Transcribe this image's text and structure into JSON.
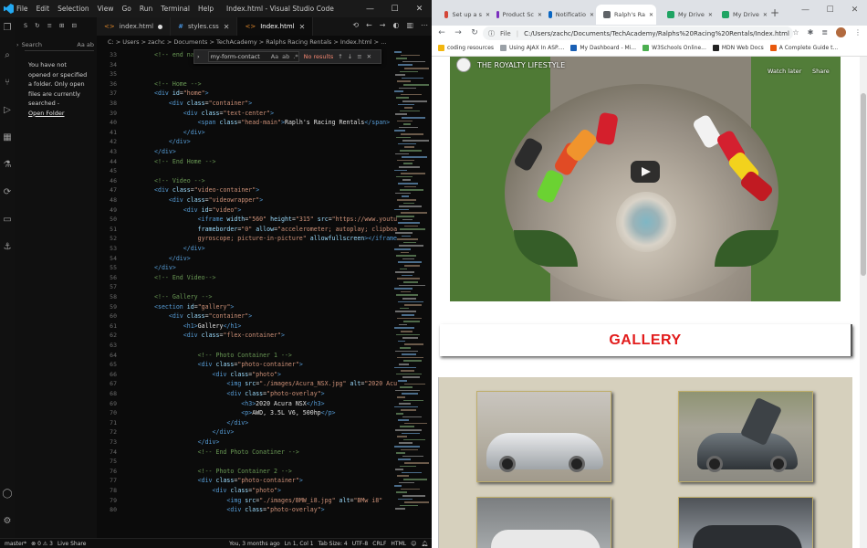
{
  "vscode": {
    "title": "Index.html - Visual Studio Code",
    "menu": [
      "File",
      "Edit",
      "Selection",
      "View",
      "Go",
      "Run",
      "Terminal",
      "Help"
    ],
    "sidebar": {
      "header": "S",
      "search_placeholder": "Search",
      "search_opts": "Aa ab",
      "message": "You have not opened or specified a folder. Only open files are currently searched -",
      "link": "Open Folder"
    },
    "tabs": [
      {
        "label": "index.html",
        "state": "modified"
      },
      {
        "label": "styles.css",
        "state": "close"
      },
      {
        "label": "Index.html",
        "state": "active"
      }
    ],
    "breadcrumb": "C: > Users > zachc > Documents > TechAcademy > Ralphs Racing Rentals > Index.html > ...",
    "find": {
      "value": "my-form-contact",
      "result": "No results"
    },
    "lines": [
      {
        "n": "33",
        "html": "<span class='c-com'>&lt;!-- end na</span>"
      },
      {
        "n": "34",
        "html": ""
      },
      {
        "n": "35",
        "html": ""
      },
      {
        "n": "36",
        "html": "<span class='c-com'>&lt;!-- Home --&gt;</span>"
      },
      {
        "n": "37",
        "html": "<span class='c-tag'>&lt;div</span> <span class='c-attr'>id</span>=<span class='c-str'>\"home\"</span><span class='c-tag'>&gt;</span>"
      },
      {
        "n": "38",
        "html": "    <span class='c-tag'>&lt;div</span> <span class='c-attr'>class</span>=<span class='c-str'>\"container\"</span><span class='c-tag'>&gt;</span>"
      },
      {
        "n": "39",
        "html": "        <span class='c-tag'>&lt;div</span> <span class='c-attr'>class</span>=<span class='c-str'>\"text-center\"</span><span class='c-tag'>&gt;</span>"
      },
      {
        "n": "40",
        "html": "            <span class='c-tag'>&lt;span</span> <span class='c-attr'>class</span>=<span class='c-str'>\"head-main\"</span><span class='c-tag'>&gt;</span><span class='c-txt'>Raplh's Racing Rentals</span><span class='c-tag'>&lt;/span&gt;</span>"
      },
      {
        "n": "41",
        "html": "        <span class='c-tag'>&lt;/div&gt;</span>"
      },
      {
        "n": "42",
        "html": "    <span class='c-tag'>&lt;/div&gt;</span>"
      },
      {
        "n": "43",
        "html": "<span class='c-tag'>&lt;/div&gt;</span>"
      },
      {
        "n": "44",
        "html": "<span class='c-com'>&lt;!-- End Home --&gt;</span>"
      },
      {
        "n": "45",
        "html": ""
      },
      {
        "n": "46",
        "html": "<span class='c-com'>&lt;!-- Video --&gt;</span>"
      },
      {
        "n": "47",
        "html": "<span class='c-tag'>&lt;div</span> <span class='c-attr'>class</span>=<span class='c-str'>\"video-container\"</span><span class='c-tag'>&gt;</span>"
      },
      {
        "n": "48",
        "html": "    <span class='c-tag'>&lt;div</span> <span class='c-attr'>class</span>=<span class='c-str'>\"videowrapper\"</span><span class='c-tag'>&gt;</span>"
      },
      {
        "n": "49",
        "html": "        <span class='c-tag'>&lt;div</span> <span class='c-attr'>id</span>=<span class='c-str'>\"video\"</span><span class='c-tag'>&gt;</span>"
      },
      {
        "n": "50",
        "html": "            <span class='c-tag'>&lt;iframe</span> <span class='c-attr'>width</span>=<span class='c-str'>\"560\"</span> <span class='c-attr'>height</span>=<span class='c-str'>\"315\"</span> <span class='c-attr'>src</span>=<span class='c-str'>\"https://www.youtu</span>"
      },
      {
        "n": "51",
        "html": "            <span class='c-attr'>frameborder</span>=<span class='c-str'>\"0\"</span> <span class='c-attr'>allow</span>=<span class='c-str'>\"accelerometer; autoplay; clipboa</span>"
      },
      {
        "n": "52",
        "html": "            <span class='c-str'>gyroscope; picture-in-picture\"</span> <span class='c-attr'>allowfullscreen</span><span class='c-tag'>&gt;&lt;/iframe</span>"
      },
      {
        "n": "53",
        "html": "        <span class='c-tag'>&lt;/div&gt;</span>"
      },
      {
        "n": "54",
        "html": "    <span class='c-tag'>&lt;/div&gt;</span>"
      },
      {
        "n": "55",
        "html": "<span class='c-tag'>&lt;/div&gt;</span>"
      },
      {
        "n": "56",
        "html": "<span class='c-com'>&lt;!-- End Video--&gt;</span>"
      },
      {
        "n": "57",
        "html": ""
      },
      {
        "n": "58",
        "html": "<span class='c-com'>&lt;!-- Gallery --&gt;</span>"
      },
      {
        "n": "59",
        "html": "<span class='c-tag'>&lt;section</span> <span class='c-attr'>id</span>=<span class='c-str'>\"gallery\"</span><span class='c-tag'>&gt;</span>"
      },
      {
        "n": "60",
        "html": "    <span class='c-tag'>&lt;div</span> <span class='c-attr'>class</span>=<span class='c-str'>\"container\"</span><span class='c-tag'>&gt;</span>"
      },
      {
        "n": "61",
        "html": "        <span class='c-tag'>&lt;h1&gt;</span><span class='c-txt'>Gallery</span><span class='c-tag'>&lt;/h1&gt;</span>"
      },
      {
        "n": "62",
        "html": "        <span class='c-tag'>&lt;div</span> <span class='c-attr'>class</span>=<span class='c-str'>\"flex-container\"</span><span class='c-tag'>&gt;</span>"
      },
      {
        "n": "63",
        "html": ""
      },
      {
        "n": "64",
        "html": "            <span class='c-com'>&lt;!-- Photo Container 1 --&gt;</span>"
      },
      {
        "n": "65",
        "html": "            <span class='c-tag'>&lt;div</span> <span class='c-attr'>class</span>=<span class='c-str'>\"photo-container\"</span><span class='c-tag'>&gt;</span>"
      },
      {
        "n": "66",
        "html": "                <span class='c-tag'>&lt;div</span> <span class='c-attr'>class</span>=<span class='c-str'>\"photo\"</span><span class='c-tag'>&gt;</span>"
      },
      {
        "n": "67",
        "html": "                    <span class='c-tag'>&lt;img</span> <span class='c-attr'>src</span>=<span class='c-str'>\"./images/Acura_NSX.jpg\"</span> <span class='c-attr'>alt</span>=<span class='c-str'>\"2020 Acu</span>"
      },
      {
        "n": "68",
        "html": "                    <span class='c-tag'>&lt;div</span> <span class='c-attr'>class</span>=<span class='c-str'>\"photo-overlay\"</span><span class='c-tag'>&gt;</span>"
      },
      {
        "n": "69",
        "html": "                        <span class='c-tag'>&lt;h3&gt;</span><span class='c-txt'>2020 Acura NSX</span><span class='c-tag'>&lt;/h3&gt;</span>"
      },
      {
        "n": "70",
        "html": "                        <span class='c-tag'>&lt;p&gt;</span><span class='c-txt'>AWD, 3.5L V6, 500hp</span><span class='c-tag'>&lt;/p&gt;</span>"
      },
      {
        "n": "71",
        "html": "                    <span class='c-tag'>&lt;/div&gt;</span>"
      },
      {
        "n": "72",
        "html": "                <span class='c-tag'>&lt;/div&gt;</span>"
      },
      {
        "n": "73",
        "html": "            <span class='c-tag'>&lt;/div&gt;</span>"
      },
      {
        "n": "74",
        "html": "            <span class='c-com'>&lt;!-- End Photo Conatiner --&gt;</span>"
      },
      {
        "n": "75",
        "html": ""
      },
      {
        "n": "76",
        "html": "            <span class='c-com'>&lt;!-- Photo Container 2 --&gt;</span>"
      },
      {
        "n": "77",
        "html": "            <span class='c-tag'>&lt;div</span> <span class='c-attr'>class</span>=<span class='c-str'>\"photo-container\"</span><span class='c-tag'>&gt;</span>"
      },
      {
        "n": "78",
        "html": "                <span class='c-tag'>&lt;div</span> <span class='c-attr'>class</span>=<span class='c-str'>\"photo\"</span><span class='c-tag'>&gt;</span>"
      },
      {
        "n": "79",
        "html": "                    <span class='c-tag'>&lt;img</span> <span class='c-attr'>src</span>=<span class='c-str'>\"./images/BMW_i8.jpg\"</span> <span class='c-attr'>alt</span>=<span class='c-str'>\"BMw i8\"</span>"
      },
      {
        "n": "80",
        "html": "                    <span class='c-tag'>&lt;div</span> <span class='c-attr'>class</span>=<span class='c-str'>\"photo-overlay\"</span><span class='c-tag'>&gt;</span>"
      }
    ],
    "status": {
      "branch": "master*",
      "problems": "⊗ 0 ⚠ 3",
      "live_share": "Live Share",
      "blame": "You, 3 months ago",
      "position": "Ln 1, Col 1",
      "tab_size": "Tab Size: 4",
      "encoding": "UTF-8",
      "eol": "CRLF",
      "language": "HTML"
    }
  },
  "chrome": {
    "tabs": [
      {
        "label": "Set up a s",
        "color": "#d44638"
      },
      {
        "label": "Product Sc",
        "color": "#7b2fbe"
      },
      {
        "label": "Notificatio",
        "color": "#0a66c2"
      },
      {
        "label": "Ralph's Ra",
        "color": "#5f6368"
      },
      {
        "label": "My Drive",
        "color": "#1fa463"
      },
      {
        "label": "My Drive",
        "color": "#1fa463"
      }
    ],
    "address": "C:/Users/zachc/Documents/TechAcademy/Ralphs%20Racing%20Rentals/Index.html",
    "address_prefix": "File",
    "bookmarks": [
      {
        "label": "coding resources",
        "color": "#f2b60f"
      },
      {
        "label": "Using AJAX In ASP....",
        "color": "#9aa0a6"
      },
      {
        "label": "My Dashboard - Mi...",
        "color": "#1a5fb4"
      },
      {
        "label": "W3Schools Online...",
        "color": "#4caf50"
      },
      {
        "label": "MDN Web Docs",
        "color": "#222222"
      },
      {
        "label": "A Complete Guide t...",
        "color": "#e8580c"
      }
    ],
    "page": {
      "video_title": "THE ROYALTY LIFESTYLE",
      "watch_later": "Watch later",
      "share": "Share",
      "gallery_heading": "GALLERY"
    }
  }
}
